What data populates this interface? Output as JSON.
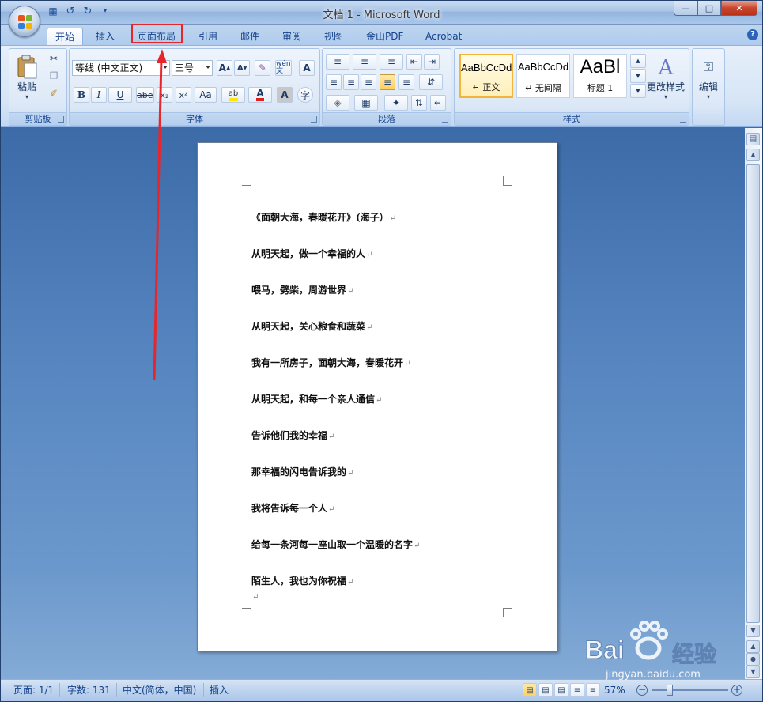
{
  "titlebar": {
    "title": "文档 1 - Microsoft Word"
  },
  "tabs": [
    {
      "label": "开始",
      "active": true
    },
    {
      "label": "插入"
    },
    {
      "label": "页面布局",
      "highlighted": true
    },
    {
      "label": "引用"
    },
    {
      "label": "邮件"
    },
    {
      "label": "审阅"
    },
    {
      "label": "视图"
    },
    {
      "label": "金山PDF"
    },
    {
      "label": "Acrobat"
    }
  ],
  "ribbon": {
    "clipboard": {
      "paste_label": "粘贴",
      "group_label": "剪贴板"
    },
    "font": {
      "font_name": "等线 (中文正文)",
      "font_size": "三号",
      "group_label": "字体",
      "bold": "B",
      "italic": "I",
      "underline": "U",
      "strike": "abe",
      "subscript": "x₂",
      "superscript": "x²",
      "case": "Aa",
      "grow": "A",
      "shrink": "A"
    },
    "paragraph": {
      "group_label": "段落"
    },
    "styles": {
      "group_label": "样式",
      "items": [
        {
          "preview": "AaBbCcDd",
          "name": "↵ 正文"
        },
        {
          "preview": "AaBbCcDd",
          "name": "↵ 无间隔"
        },
        {
          "preview": "AaBl",
          "name": "标题 1"
        }
      ],
      "change_styles": "更改样式"
    },
    "editing": {
      "label": "编辑"
    }
  },
  "document": {
    "lines": [
      "《面朝大海，春暖花开》(海子）",
      "从明天起，做一个幸福的人",
      "喂马，劈柴，周游世界",
      "从明天起，关心粮食和蔬菜",
      "我有一所房子，面朝大海，春暖花开",
      "从明天起，和每一个亲人通信",
      "告诉他们我的幸福",
      "那幸福的闪电告诉我的",
      "我将告诉每一个人",
      "给每一条河每一座山取一个温暖的名字",
      "陌生人，我也为你祝福"
    ],
    "para_mark": "↵"
  },
  "status": {
    "page": "页面: 1/1",
    "words": "字数: 131",
    "language": "中文(简体，中国)",
    "mode": "插入",
    "zoom": "57%"
  },
  "watermark": {
    "brand": "Bai",
    "brand2": "经验",
    "url": "jingyan.baidu.com"
  },
  "colors": {
    "annotation_red": "#e8252b"
  }
}
